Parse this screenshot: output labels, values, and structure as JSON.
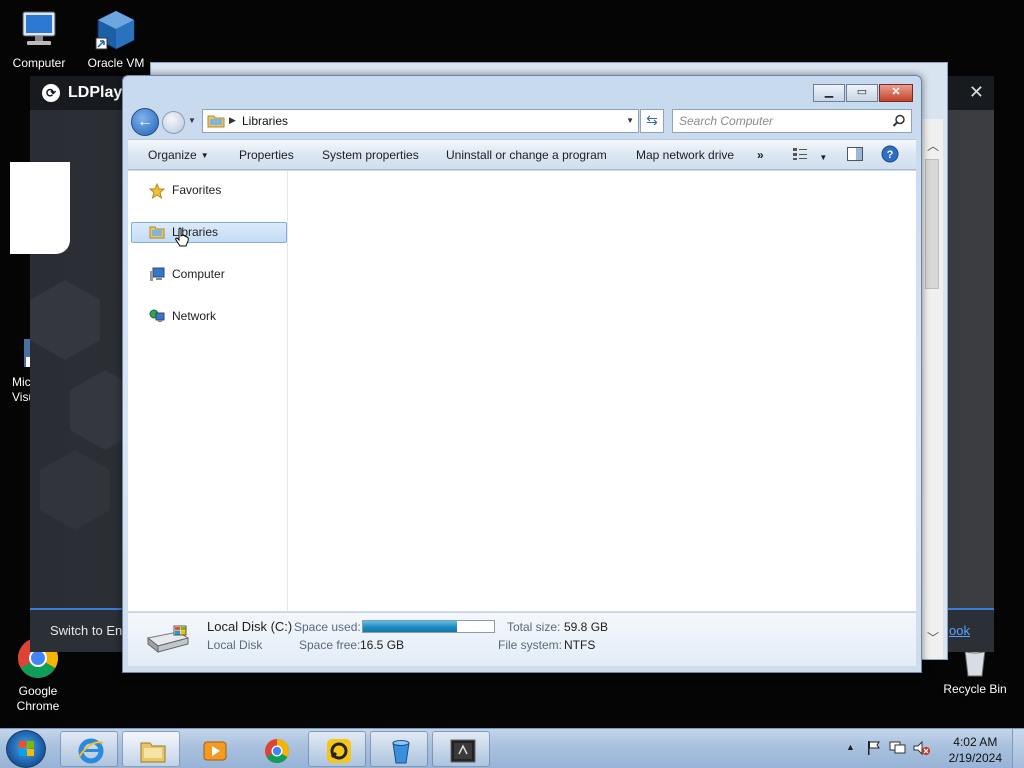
{
  "desktop": {
    "icons": [
      {
        "label": "Computer"
      },
      {
        "label": "Oracle VM"
      },
      {
        "label": "Mic Visua"
      },
      {
        "label": "Google Chrome"
      },
      {
        "label": "Recycle Bin"
      }
    ]
  },
  "ldplayer": {
    "title": "LDPlaye",
    "switch_text": "Switch to Eng",
    "link_text": "ook"
  },
  "explorer": {
    "address": {
      "crumb": "Libraries"
    },
    "search": {
      "placeholder": "Search Computer"
    },
    "commands": [
      {
        "label": "Organize"
      },
      {
        "label": "Properties"
      },
      {
        "label": "System properties"
      },
      {
        "label": "Uninstall or change a program"
      },
      {
        "label": "Map network drive"
      },
      {
        "label": "»"
      }
    ],
    "nav_items": [
      {
        "label": "Favorites"
      },
      {
        "label": "Libraries"
      },
      {
        "label": "Computer"
      },
      {
        "label": "Network"
      }
    ],
    "details": {
      "drive_name": "Local Disk (C:)",
      "drive_type": "Local Disk",
      "space_used_label": "Space used:",
      "space_used_fraction": 0.72,
      "space_free_label": "Space free:",
      "space_free_value": "16.5 GB",
      "total_size_label": "Total size:",
      "total_size_value": "59.8 GB",
      "file_system_label": "File system:",
      "file_system_value": "NTFS"
    }
  },
  "taskbar": {
    "clock_time": "4:02 AM",
    "clock_date": "2/19/2024"
  },
  "colors": {
    "accent": "#3b7bd9",
    "selection": "#c4dcf6",
    "space_bar": "#1f8ac0"
  }
}
